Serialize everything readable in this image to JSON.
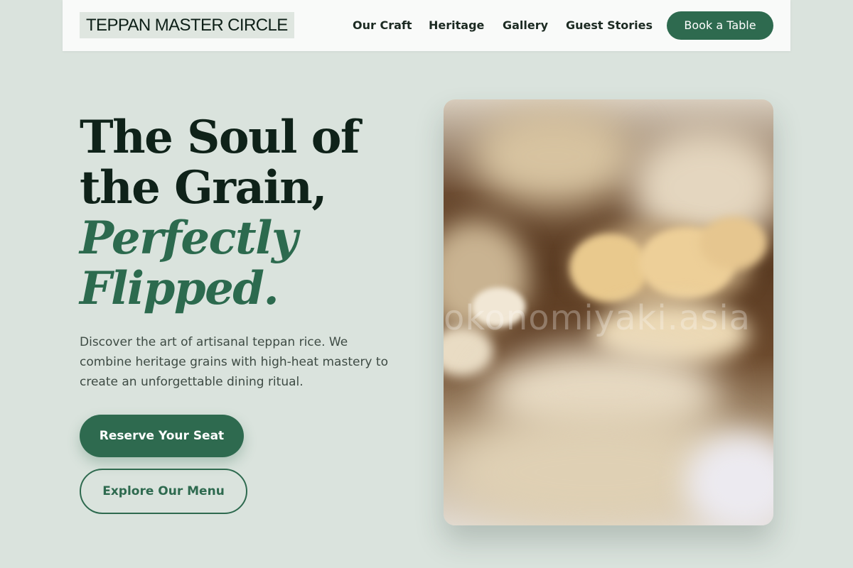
{
  "header": {
    "logo": "TEPPAN MASTER CIRCLE",
    "nav": [
      {
        "label": "Our Craft"
      },
      {
        "label": "Heritage"
      },
      {
        "label": "Gallery"
      },
      {
        "label": "Guest Stories"
      }
    ],
    "cta_label": "Book a Table"
  },
  "hero": {
    "title_lines": [
      "The Soul of",
      "the Grain,"
    ],
    "title_accent_lines": [
      "Perfectly",
      "Flipped."
    ],
    "description_lines": [
      "Discover the art of artisanal teppan rice. We",
      "combine heritage grains with high-heat mastery to",
      "create an unforgettable dining ritual."
    ],
    "primary_button": "Reserve Your Seat",
    "secondary_button": "Explore Our Menu",
    "image_watermark": "okonomiyaki.asia"
  },
  "colors": {
    "page_background": "#dae3dd",
    "header_background": "#f9faf9",
    "brand_green": "#2e6a4f",
    "heading_dark": "#0f2219",
    "accent_green": "#2c6a4e",
    "body_text": "#3e4b44"
  }
}
